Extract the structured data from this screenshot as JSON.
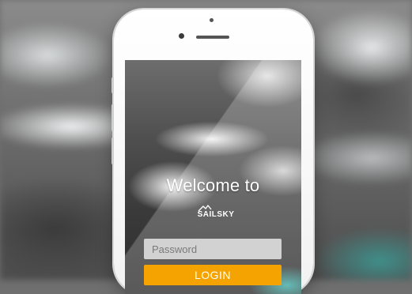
{
  "login_screen": {
    "welcome_text": "Welcome to",
    "brand_logo_text": "SAILSKY",
    "password_placeholder": "Password",
    "password_value": "",
    "login_label": "LOGIN"
  },
  "colors": {
    "login_button": "#f5a300",
    "input_background": "#ebebeb",
    "phone_body": "#ffffff"
  },
  "icons": {
    "brand_mark": "sailsky-mountain-logo-icon"
  }
}
